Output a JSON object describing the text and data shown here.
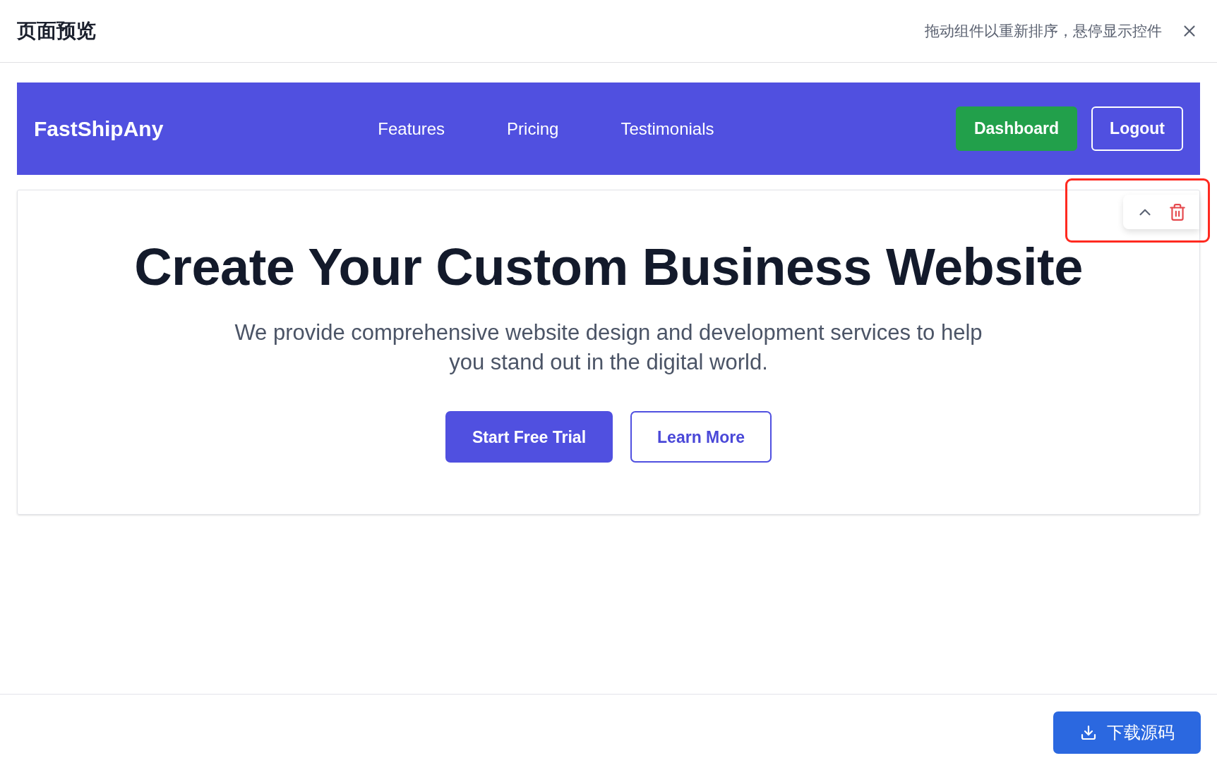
{
  "dialog": {
    "title": "页面预览",
    "hint": "拖动组件以重新排序，悬停显示控件"
  },
  "navbar": {
    "logo": "FastShipAny",
    "links": [
      "Features",
      "Pricing",
      "Testimonials"
    ],
    "buttons": [
      {
        "label": "Dashboard",
        "kind": "filled"
      },
      {
        "label": "Logout",
        "kind": "outline"
      }
    ]
  },
  "hero": {
    "title": "Create Your Custom Business Website",
    "subtitle": "We provide comprehensive website design and development services to help you stand out in the digital world.",
    "buttons": [
      {
        "label": "Start Free Trial",
        "kind": "filled"
      },
      {
        "label": "Learn More",
        "kind": "outline"
      }
    ],
    "controls": {
      "highlighted": true
    }
  },
  "footer": {
    "download_button": "下载源码"
  }
}
